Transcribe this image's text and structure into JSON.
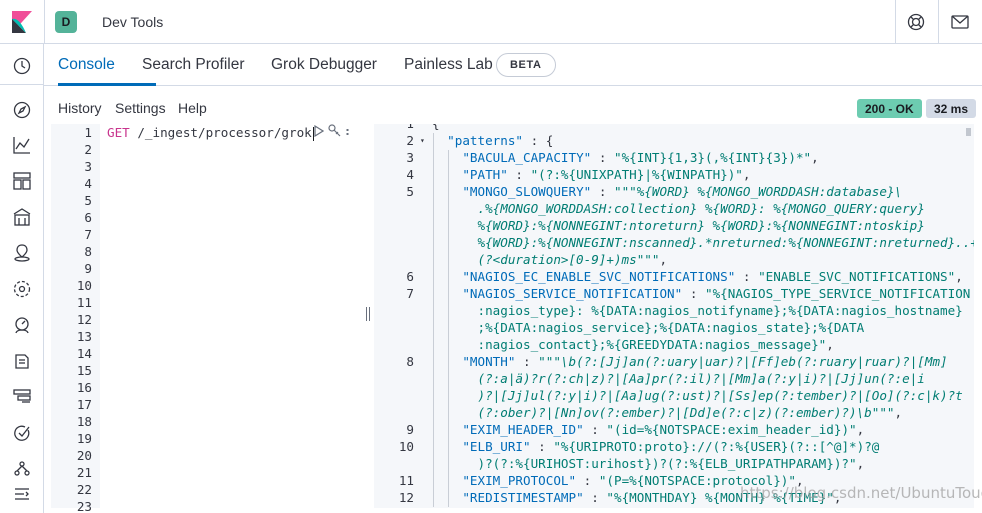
{
  "app": {
    "title": "Dev Tools",
    "deck_initial": "D",
    "accent": "#006bb8",
    "icons": [
      "kibana-logo-icon",
      "help-icon",
      "mail-icon"
    ]
  },
  "sidenav": {
    "icons": [
      "recently-viewed-icon",
      "discover-icon",
      "visualize-icon",
      "dashboard-icon",
      "canvas-icon",
      "maps-icon",
      "ml-icon",
      "metrics-icon",
      "logs-icon",
      "apm-icon",
      "uptime-icon",
      "graph-icon",
      "collapse-icon"
    ]
  },
  "tabs": [
    {
      "label": "Console",
      "active": true
    },
    {
      "label": "Search Profiler",
      "active": false
    },
    {
      "label": "Grok Debugger",
      "active": false
    },
    {
      "label": "Painless Lab",
      "active": false
    }
  ],
  "beta_label": "BETA",
  "submenu": {
    "history": "History",
    "settings": "Settings",
    "help": "Help"
  },
  "status": {
    "code": "200 - OK",
    "time": "32 ms",
    "ok_color": "#6dccb1"
  },
  "request": {
    "method": "GET",
    "url": "/_ingest/processor/grok",
    "line_numbers": [
      "1",
      "2",
      "3",
      "4",
      "5",
      "6",
      "7",
      "8",
      "9",
      "10",
      "11",
      "12",
      "13",
      "14",
      "15",
      "16",
      "17",
      "18",
      "19",
      "20",
      "21",
      "22",
      "23"
    ]
  },
  "response": {
    "line_numbers": [
      {
        "n": "1",
        "row": 0
      },
      {
        "n": "2",
        "row": 1
      },
      {
        "n": "3",
        "row": 2
      },
      {
        "n": "4",
        "row": 3
      },
      {
        "n": "5",
        "row": 4
      },
      {
        "n": "6",
        "row": 9
      },
      {
        "n": "7",
        "row": 10
      },
      {
        "n": "8",
        "row": 14
      },
      {
        "n": "9",
        "row": 18
      },
      {
        "n": "10",
        "row": 19
      },
      {
        "n": "11",
        "row": 21
      },
      {
        "n": "12",
        "row": 22
      }
    ],
    "lines": [
      {
        "parts": [
          [
            "p",
            "{"
          ]
        ]
      },
      {
        "parts": [
          [
            "p",
            "  "
          ],
          [
            "k",
            "\"patterns\""
          ],
          [
            "p",
            " : {"
          ]
        ]
      },
      {
        "parts": [
          [
            "p",
            "    "
          ],
          [
            "k",
            "\"BACULA_CAPACITY\""
          ],
          [
            "p",
            " : "
          ],
          [
            "v",
            "\"%{INT}{1,3}(,%{INT}{3})*\""
          ],
          [
            "p",
            ","
          ]
        ]
      },
      {
        "parts": [
          [
            "p",
            "    "
          ],
          [
            "k",
            "\"PATH\""
          ],
          [
            "p",
            " : "
          ],
          [
            "v",
            "\"(?:%{UNIXPATH}|%{WINPATH})\""
          ],
          [
            "p",
            ","
          ]
        ]
      },
      {
        "parts": [
          [
            "p",
            "    "
          ],
          [
            "k",
            "\"MONGO_SLOWQUERY\""
          ],
          [
            "p",
            " : "
          ],
          [
            "v",
            "\"\"\""
          ],
          [
            "m",
            "%{WORD} %{MONGO_WORDDASH:database}\\"
          ]
        ]
      },
      {
        "parts": [
          [
            "m",
            "      .%{MONGO_WORDDASH:collection} %{WORD}: %{MONGO_QUERY:query}"
          ]
        ]
      },
      {
        "parts": [
          [
            "m",
            "      %{WORD}:%{NONNEGINT:ntoreturn} %{WORD}:%{NONNEGINT:ntoskip}"
          ]
        ]
      },
      {
        "parts": [
          [
            "m",
            "      %{WORD}:%{NONNEGINT:nscanned}.*nreturned:%{NONNEGINT:nreturned}..+"
          ]
        ]
      },
      {
        "parts": [
          [
            "m",
            "      (?<duration>[0-9]+)ms"
          ],
          [
            "v",
            "\"\"\""
          ],
          [
            "p",
            ","
          ]
        ]
      },
      {
        "parts": [
          [
            "p",
            "    "
          ],
          [
            "k",
            "\"NAGIOS_EC_ENABLE_SVC_NOTIFICATIONS\""
          ],
          [
            "p",
            " : "
          ],
          [
            "v",
            "\"ENABLE_SVC_NOTIFICATIONS\""
          ],
          [
            "p",
            ","
          ]
        ]
      },
      {
        "parts": [
          [
            "p",
            "    "
          ],
          [
            "k",
            "\"NAGIOS_SERVICE_NOTIFICATION\""
          ],
          [
            "p",
            " : "
          ],
          [
            "v",
            "\"%{NAGIOS_TYPE_SERVICE_NOTIFICATION"
          ]
        ]
      },
      {
        "parts": [
          [
            "v",
            "      :nagios_type}: %{DATA:nagios_notifyname};%{DATA:nagios_hostname}"
          ]
        ]
      },
      {
        "parts": [
          [
            "v",
            "      ;%{DATA:nagios_service};%{DATA:nagios_state};%{DATA"
          ]
        ]
      },
      {
        "parts": [
          [
            "v",
            "      :nagios_contact};%{GREEDYDATA:nagios_message}\""
          ],
          [
            "p",
            ","
          ]
        ]
      },
      {
        "parts": [
          [
            "p",
            "    "
          ],
          [
            "k",
            "\"MONTH\""
          ],
          [
            "p",
            " : "
          ],
          [
            "v",
            "\"\"\""
          ],
          [
            "m",
            "\\b(?:[Jj]an(?:uary|uar)?|[Ff]eb(?:ruary|ruar)?|[Mm]"
          ]
        ]
      },
      {
        "parts": [
          [
            "m",
            "      (?:a|ä)?r(?:ch|z)?|[Aa]pr(?:il)?|[Mm]a(?:y|i)?|[Jj]un(?:e|i"
          ]
        ]
      },
      {
        "parts": [
          [
            "m",
            "      )?|[Jj]ul(?:y|i)?|[Aa]ug(?:ust)?|[Ss]ep(?:tember)?|[Oo](?:c|k)?t"
          ]
        ]
      },
      {
        "parts": [
          [
            "m",
            "      (?:ober)?|[Nn]ov(?:ember)?|[Dd]e(?:c|z)(?:ember)?)\\b"
          ],
          [
            "v",
            "\"\"\""
          ],
          [
            "p",
            ","
          ]
        ]
      },
      {
        "parts": [
          [
            "p",
            "    "
          ],
          [
            "k",
            "\"EXIM_HEADER_ID\""
          ],
          [
            "p",
            " : "
          ],
          [
            "v",
            "\"(id=%{NOTSPACE:exim_header_id})\""
          ],
          [
            "p",
            ","
          ]
        ]
      },
      {
        "parts": [
          [
            "p",
            "    "
          ],
          [
            "k",
            "\"ELB_URI\""
          ],
          [
            "p",
            " : "
          ],
          [
            "v",
            "\"%{URIPROTO:proto}://(?:%{USER}(?::[^@]*)?@"
          ]
        ]
      },
      {
        "parts": [
          [
            "v",
            "      )?(?:%{URIHOST:urihost})?(?:%{ELB_URIPATHPARAM})?\""
          ],
          [
            "p",
            ","
          ]
        ]
      },
      {
        "parts": [
          [
            "p",
            "    "
          ],
          [
            "k",
            "\"EXIM_PROTOCOL\""
          ],
          [
            "p",
            " : "
          ],
          [
            "v",
            "\"(P=%{NOTSPACE:protocol})\""
          ],
          [
            "p",
            ","
          ]
        ]
      },
      {
        "parts": [
          [
            "p",
            "    "
          ],
          [
            "k",
            "\"REDISTIMESTAMP\""
          ],
          [
            "p",
            " : "
          ],
          [
            "v",
            "\"%{MONTHDAY} %{MONTH} %{TIME}\""
          ],
          [
            "p",
            ","
          ]
        ]
      }
    ]
  },
  "watermark": "https://blog.csdn.net/UbuntuTouch"
}
